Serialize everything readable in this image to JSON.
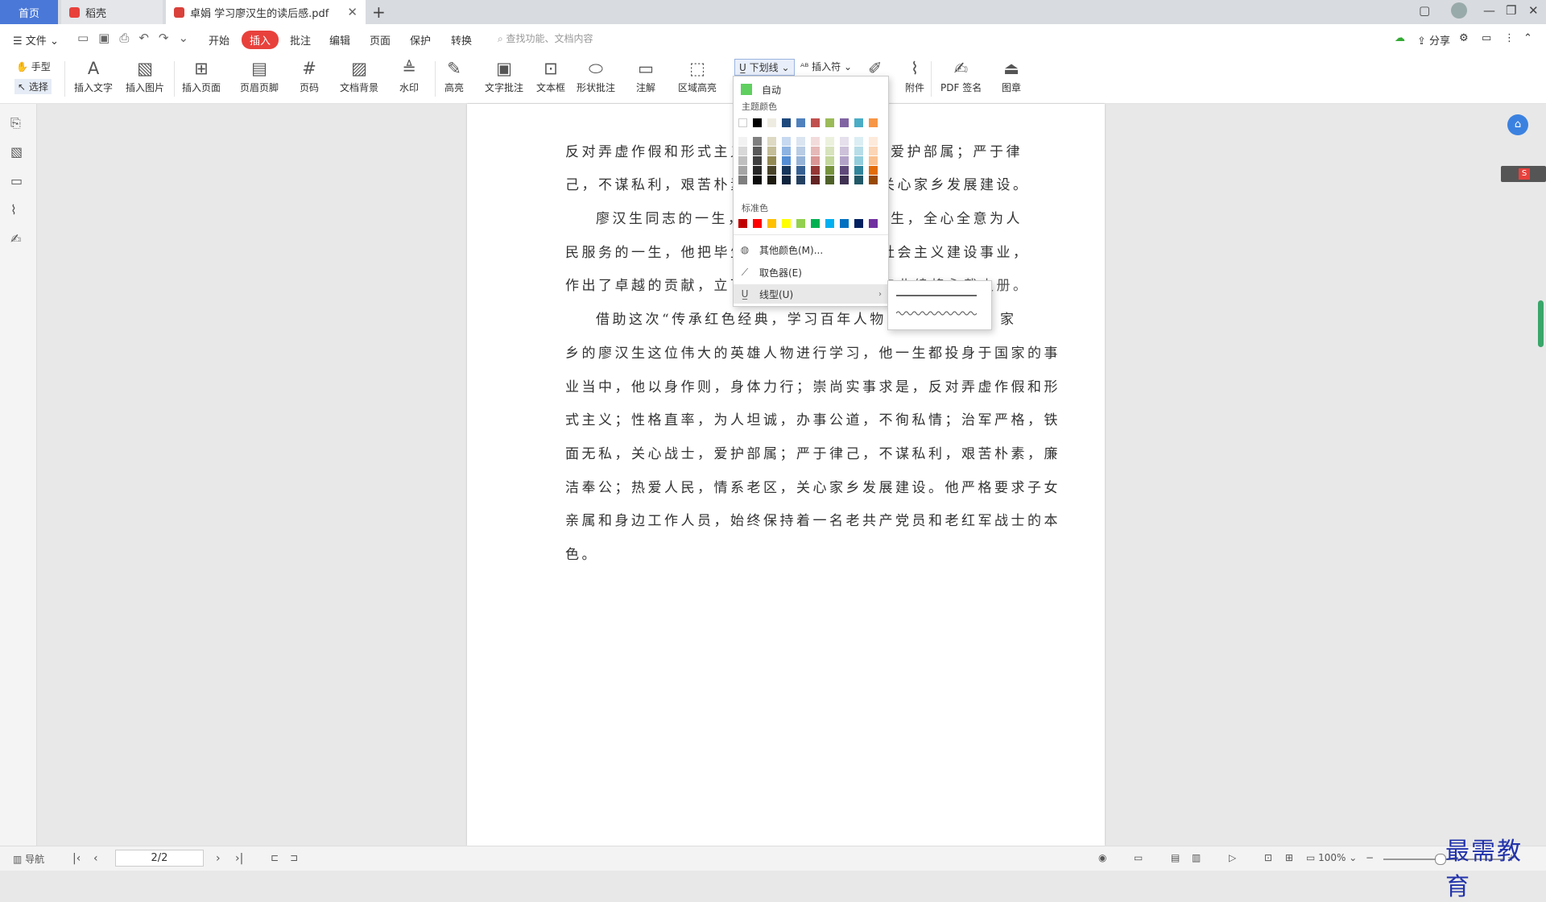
{
  "tabs": {
    "home": "首页",
    "daoke": "稻壳",
    "document": "卓娟 学习廖汉生的读后感.pdf"
  },
  "menubar": {
    "file": "文件",
    "items": [
      "开始",
      "插入",
      "批注",
      "编辑",
      "页面",
      "保护",
      "转换"
    ],
    "search_placeholder": "查找功能、文档内容",
    "share": "分享"
  },
  "toolbar": {
    "hand": "手型",
    "select": "选择",
    "insert_text": "插入文字",
    "insert_image": "插入图片",
    "insert_page": "插入页面",
    "header_footer": "页眉页脚",
    "page_number": "页码",
    "doc_background": "文档背景",
    "watermark": "水印",
    "highlight": "高亮",
    "text_annot": "文字批注",
    "textbox": "文本框",
    "shape_annot": "形状批注",
    "note": "注解",
    "area_highlight": "区域高亮",
    "underline": "下划线",
    "insert_symbol": "插入符",
    "attachment": "附件",
    "pdf_sign": "PDF 签名",
    "stamp": "图章"
  },
  "dropdown": {
    "auto": "自动",
    "theme_colors": "主题颜色",
    "standard_colors": "标准色",
    "more_colors": "其他颜色(M)...",
    "picker": "取色器(E)",
    "line_type": "线型(U)",
    "theme_top": [
      "#ffffff",
      "#000000",
      "#eeece1",
      "#1f497d",
      "#4f81bd",
      "#c0504d",
      "#9bbb59",
      "#8064a2",
      "#4bacc6",
      "#f79646"
    ],
    "theme_shades": [
      [
        "#f2f2f2",
        "#7f7f7f",
        "#ddd9c3",
        "#c6d9f0",
        "#dbe5f1",
        "#f2dcdb",
        "#ebf1dd",
        "#e5e0ec",
        "#dbeef3",
        "#fdeada"
      ],
      [
        "#d8d8d8",
        "#595959",
        "#c4bd97",
        "#8db3e2",
        "#b8cce4",
        "#e5b9b7",
        "#d7e3bc",
        "#ccc1d9",
        "#b7dde8",
        "#fbd5b5"
      ],
      [
        "#bfbfbf",
        "#3f3f3f",
        "#938953",
        "#548dd4",
        "#95b3d7",
        "#d99694",
        "#c3d69b",
        "#b2a2c7",
        "#92cddc",
        "#fac08f"
      ],
      [
        "#a5a5a5",
        "#262626",
        "#494429",
        "#17365d",
        "#366092",
        "#953734",
        "#76923c",
        "#5f497a",
        "#31859b",
        "#e36c09"
      ],
      [
        "#7f7f7f",
        "#0c0c0c",
        "#1d1b10",
        "#0f243e",
        "#244061",
        "#632423",
        "#4f6128",
        "#3f3151",
        "#205867",
        "#974806"
      ]
    ],
    "standard": [
      "#c00000",
      "#ff0000",
      "#ffc000",
      "#ffff00",
      "#92d050",
      "#00b050",
      "#00b0f0",
      "#0070c0",
      "#002060",
      "#7030a0"
    ],
    "auto_color": "#5fcf5f"
  },
  "document": {
    "lines": [
      "反对弄虚作假和形式主义；",
      "己，不谋私利，艰苦朴素，",
      "廖汉生同志的一生，是",
      "民服务的一生，他把毕生精",
      "作出了卓越的贡献，立下",
      "借助这次“传承红色经典，学习百年人物”活",
      "乡的廖汉生这位伟大的英雄人物进行学习，他一生都投身于国家的事",
      "业当中，他以身作则，身体力行；崇尚实事求是，反对弄虚作假和形",
      "式主义；性格直率，为人坦诚，办事公道，不徇私情；治军严格，铁",
      "面无私，关心战士，爱护部属；严于律己，不谋私利，艰苦朴素，廉",
      "洁奉公；热爱人民，情系老区，关心家乡发展建设。他严格要求子女",
      "亲属和身边工作人员，始终保持着一名老共产党员和老红军战士的本",
      "色。"
    ],
    "fragments": {
      "r1": "爱护部属；严于律",
      "r2": "关心家乡发展建设。",
      "r3": "生，全心全意为人",
      "r4": "社会主义建设事业，",
      "r5": "产业续将永载史册。",
      "r6": "家"
    }
  },
  "statusbar": {
    "nav": "导航",
    "page": "2/2",
    "zoom": "100%"
  },
  "watermark": "最需教育"
}
